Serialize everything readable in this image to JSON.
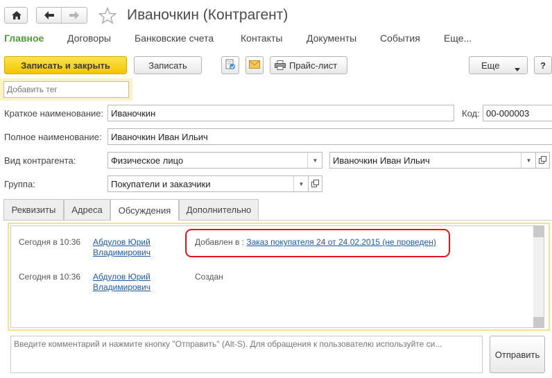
{
  "window": {
    "title": "Иваночкин (Контрагент)"
  },
  "nav": {
    "home_icon": "home-icon",
    "back_icon": "arrow-left-icon",
    "forward_icon": "arrow-right-icon",
    "favorite_icon": "star-icon"
  },
  "menu": {
    "items": [
      "Главное",
      "Договоры",
      "Банковские счета",
      "Контакты",
      "Документы",
      "События",
      "Еще..."
    ],
    "active": "Главное"
  },
  "toolbar": {
    "save_close": "Записать и закрыть",
    "save": "Записать",
    "price_list": "Прайс-лист",
    "more": "Еще",
    "help": "?"
  },
  "tag": {
    "placeholder": "Добавить тег"
  },
  "form": {
    "short_name_label": "Краткое наименование:",
    "short_name": "Иваночкин",
    "code_label": "Код:",
    "code": "00-000003",
    "full_name_label": "Полное наименование:",
    "full_name": "Иваночкин Иван Ильич",
    "type_label": "Вид контрагента:",
    "type_value": "Физическое лицо",
    "person_value": "Иваночкин Иван Ильич",
    "group_label": "Группа:",
    "group_value": "Покупатели и заказчики"
  },
  "tabs": [
    "Реквизиты",
    "Адреса",
    "Обсуждения",
    "Дополнительно"
  ],
  "active_tab": "Обсуждения",
  "discussion": {
    "messages": [
      {
        "date": "Сегодня в 10:36",
        "author_line1": "Абдулов Юрий",
        "author_line2": "Владимирович",
        "prefix": "Добавлен в :",
        "link": "Заказ покупателя 24 от 24.02.2015 (не проведен)"
      },
      {
        "date": "Сегодня в 10:36",
        "author_line1": "Абдулов Юрий",
        "author_line2": "Владимирович",
        "text": "Создан"
      }
    ],
    "highlight_color": "#e0161c",
    "comment_placeholder": "Введите комментарий и нажмите кнопку \"Отправить\" (Alt-S). Для обращения к пользователю используйте си...",
    "send_label": "Отправить"
  },
  "colors": {
    "accent_green": "#4f9a3a",
    "primary_yellow": "#f2c600",
    "link_blue": "#1a5aa8",
    "tag_highlight": "#fbf3c4"
  }
}
